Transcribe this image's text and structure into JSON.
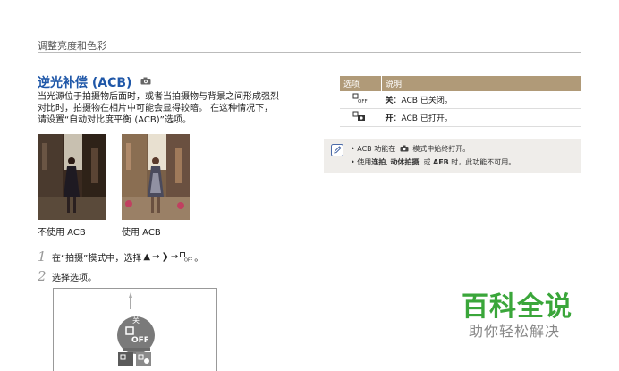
{
  "header": {
    "text": "调整亮度和色彩"
  },
  "section": {
    "title": "逆光补偿 (ACB)",
    "paragraph": [
      "当光源位于拍摄物后面时，或者当拍摄物与背景之间形成强烈",
      "对比时，拍摄物在相片中可能会显得较暗。 在这种情况下，",
      "请设置“自动对比度平衡 (ACB)”选项。"
    ]
  },
  "photos": {
    "left_caption": "不使用 ACB",
    "right_caption": "使用 ACB"
  },
  "steps": [
    {
      "num": "1",
      "text_a": "在“拍摄”模式中，选择",
      "arrow1": "→",
      "arrow2": "→",
      "end": "。"
    },
    {
      "num": "2",
      "text_a": "选择选项。"
    }
  ],
  "screen": {
    "label": "关"
  },
  "table": {
    "headers": [
      "选项",
      "说明"
    ],
    "rows": [
      {
        "label": "关",
        "desc": "：ACB 已关闭。"
      },
      {
        "label": "开",
        "desc": "：ACB 已打开。"
      }
    ]
  },
  "note": {
    "line1": {
      "a": "ACB 功能在",
      "b": "模式中始终打开。"
    },
    "line2": {
      "a": "使用",
      "b1": "连拍",
      "sep1": ", ",
      "b2": "动体拍摄",
      "c": ", 或",
      "b3": "AEB",
      "d": " 时，此功能不可用。"
    }
  },
  "watermark": {
    "main": "百科全说",
    "sub": "助你轻松解决"
  },
  "colors": {
    "title_blue": "#1f57a8",
    "table_header": "#b09a78",
    "watermark_green": "#3aa63a"
  }
}
